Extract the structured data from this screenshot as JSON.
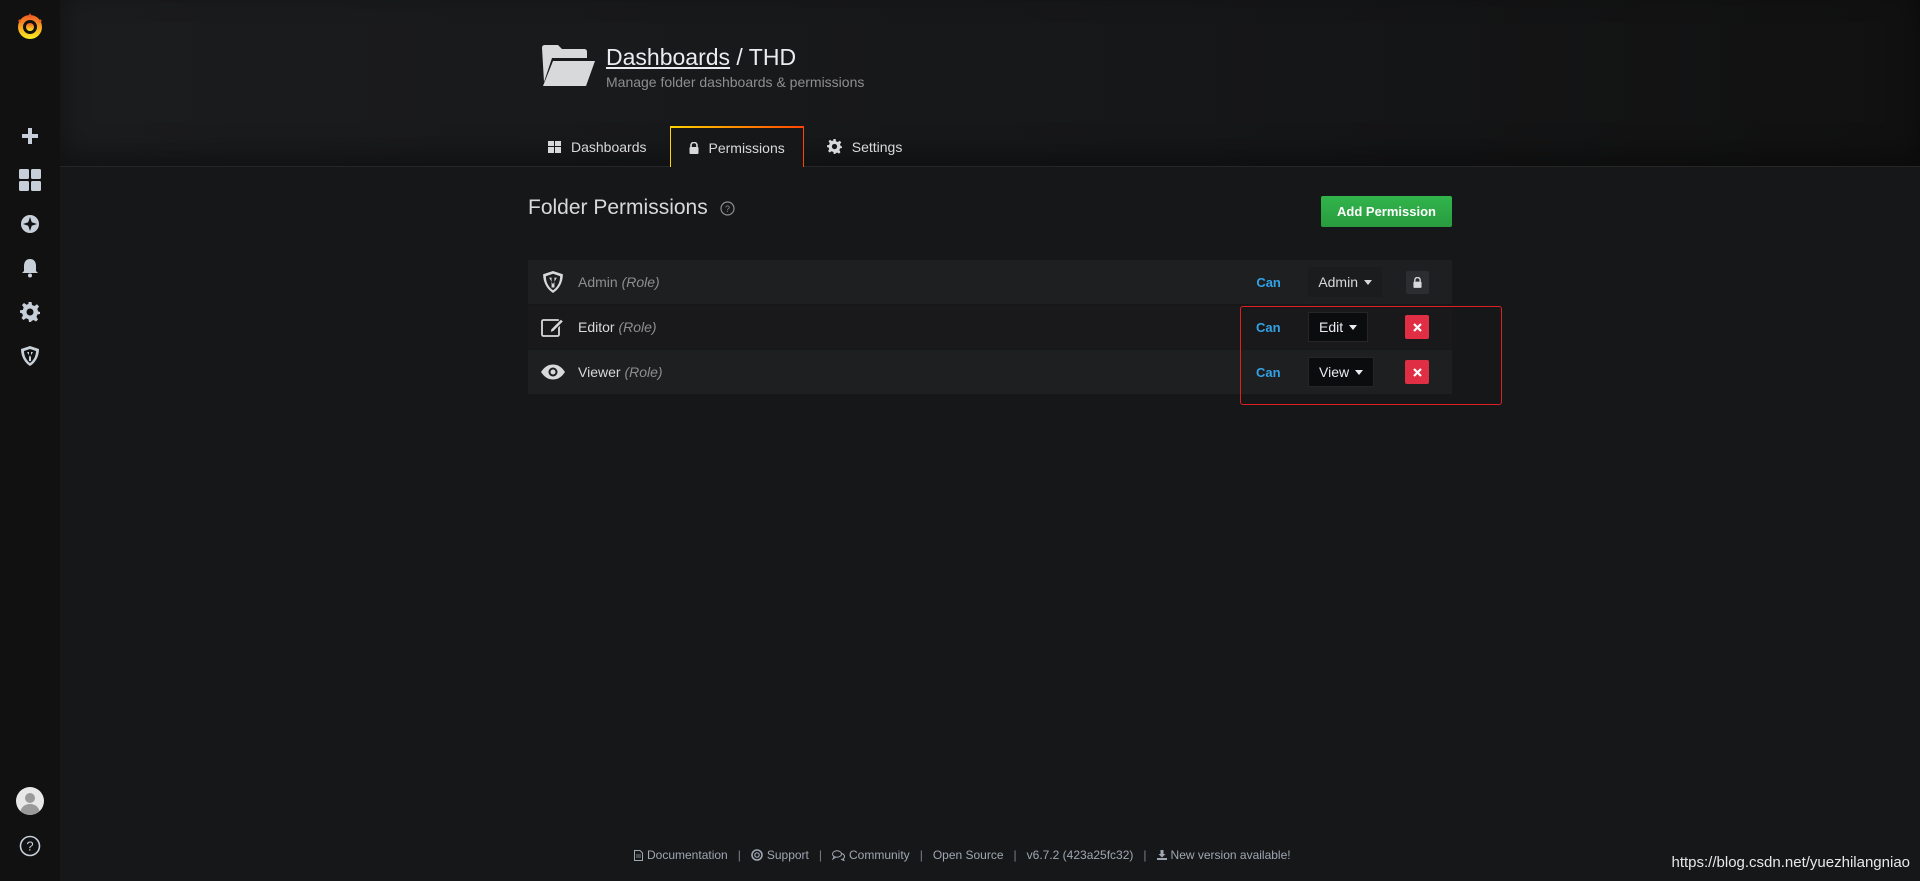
{
  "sidebar": {
    "items": [
      {
        "name": "create",
        "icon": "plus-icon"
      },
      {
        "name": "dashboards",
        "icon": "dashboard-grid-icon"
      },
      {
        "name": "explore",
        "icon": "compass-icon"
      },
      {
        "name": "alerting",
        "icon": "bell-icon"
      },
      {
        "name": "configuration",
        "icon": "gear-icon"
      },
      {
        "name": "server-admin",
        "icon": "shield-icon"
      }
    ],
    "bottom": [
      {
        "name": "profile",
        "icon": "avatar"
      },
      {
        "name": "help",
        "icon": "question-icon"
      }
    ]
  },
  "header": {
    "breadcrumb": "Dashboards",
    "separator": " / ",
    "folder": "THD",
    "subtitle": "Manage folder dashboards & permissions"
  },
  "tabs": [
    {
      "label": "Dashboards",
      "icon": "grid-icon",
      "active": false
    },
    {
      "label": "Permissions",
      "icon": "lock-icon",
      "active": true
    },
    {
      "label": "Settings",
      "icon": "gear-icon",
      "active": false
    }
  ],
  "permissions": {
    "title": "Folder Permissions",
    "add_button": "Add Permission",
    "rows": [
      {
        "name": "Admin",
        "role": "(Role)",
        "can": "Can",
        "level": "Admin",
        "icon": "shield-icon",
        "locked": true
      },
      {
        "name": "Editor",
        "role": "(Role)",
        "can": "Can",
        "level": "Edit",
        "icon": "edit-icon",
        "locked": false
      },
      {
        "name": "Viewer",
        "role": "(Role)",
        "can": "Can",
        "level": "View",
        "icon": "eye-icon",
        "locked": false
      }
    ]
  },
  "footer": {
    "documentation": "Documentation",
    "support": "Support",
    "community": "Community",
    "open_source": "Open Source",
    "version": "v6.7.2 (423a25fc32)",
    "new_version": "New version available!",
    "separator": "|"
  },
  "watermark": "https://blog.csdn.net/yuezhilangniao",
  "colors": {
    "accent_blue": "#33a2e5",
    "add_green": "#299c3f",
    "delete_red": "#e02f44",
    "highlight_red": "#e02020",
    "background": "#161719"
  }
}
